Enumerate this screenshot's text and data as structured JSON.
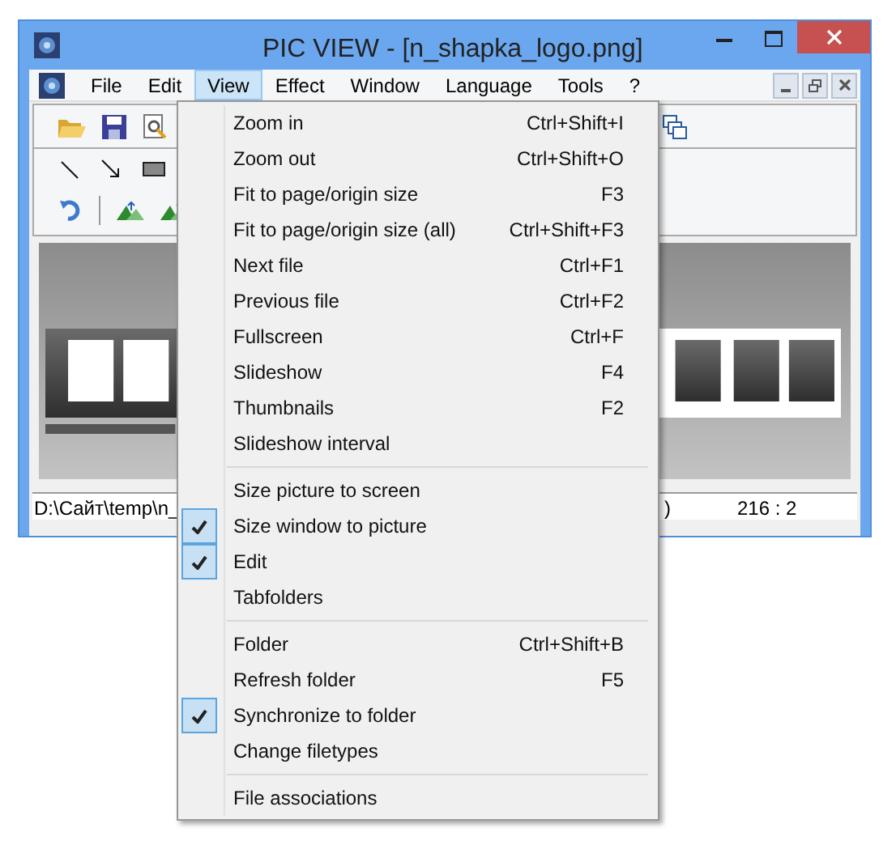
{
  "window": {
    "title": "PIC VIEW  - [n_shapka_logo.png]"
  },
  "menu_bar": [
    {
      "label": "File",
      "selected": false
    },
    {
      "label": "Edit",
      "selected": false
    },
    {
      "label": "View",
      "selected": true
    },
    {
      "label": "Effect",
      "selected": false
    },
    {
      "label": "Window",
      "selected": false
    },
    {
      "label": "Language",
      "selected": false
    },
    {
      "label": "Tools",
      "selected": false
    },
    {
      "label": "?",
      "selected": false
    }
  ],
  "view_menu": {
    "groups": [
      [
        {
          "label": "Zoom in",
          "shortcut": "Ctrl+Shift+I",
          "checked": false
        },
        {
          "label": "Zoom out",
          "shortcut": "Ctrl+Shift+O",
          "checked": false
        },
        {
          "label": "Fit to page/origin size",
          "shortcut": "F3",
          "checked": false
        },
        {
          "label": "Fit to page/origin size (all)",
          "shortcut": "Ctrl+Shift+F3",
          "checked": false
        },
        {
          "label": "Next file",
          "shortcut": "Ctrl+F1",
          "checked": false
        },
        {
          "label": "Previous file",
          "shortcut": "Ctrl+F2",
          "checked": false
        },
        {
          "label": "Fullscreen",
          "shortcut": "Ctrl+F",
          "checked": false
        },
        {
          "label": "Slideshow",
          "shortcut": "F4",
          "checked": false
        },
        {
          "label": "Thumbnails",
          "shortcut": "F2",
          "checked": false
        },
        {
          "label": "Slideshow interval",
          "checked": false
        }
      ],
      [
        {
          "label": "Size picture to screen",
          "checked": false
        },
        {
          "label": "Size window to picture",
          "checked": true
        },
        {
          "label": "Edit",
          "checked": true
        },
        {
          "label": "Tabfolders",
          "checked": false
        }
      ],
      [
        {
          "label": "Folder",
          "shortcut": "Ctrl+Shift+B",
          "checked": false
        },
        {
          "label": "Refresh folder",
          "shortcut": "F5",
          "checked": false
        },
        {
          "label": "Synchronize to folder",
          "checked": true
        },
        {
          "label": "Change filetypes",
          "checked": false
        }
      ],
      [
        {
          "label": "File associations",
          "checked": false
        }
      ]
    ]
  },
  "status_bar": {
    "path": "D:\\Сайт\\temp\\n_",
    "field_2": ")",
    "field_3": "216 : 2"
  }
}
